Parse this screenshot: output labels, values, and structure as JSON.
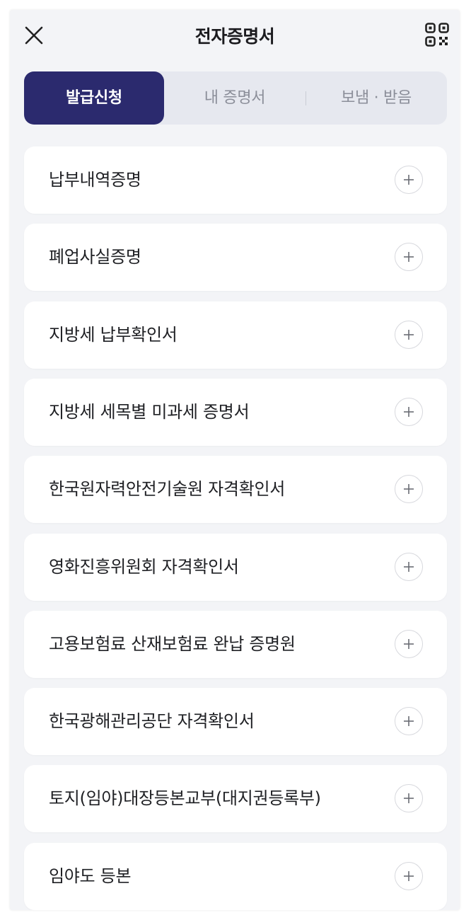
{
  "header": {
    "title": "전자증명서",
    "close_icon": "close-icon",
    "qr_icon": "qr-code-icon"
  },
  "tabs": [
    {
      "label": "발급신청",
      "active": true
    },
    {
      "label": "내 증명서",
      "active": false
    },
    {
      "label": "보냄 · 받음",
      "active": false
    }
  ],
  "certificates": [
    {
      "label": "납부내역증명"
    },
    {
      "label": "폐업사실증명"
    },
    {
      "label": "지방세 납부확인서"
    },
    {
      "label": "지방세 세목별 미과세 증명서"
    },
    {
      "label": "한국원자력안전기술원 자격확인서"
    },
    {
      "label": "영화진흥위원회 자격확인서"
    },
    {
      "label": "고용보험료 산재보험료 완납 증명원"
    },
    {
      "label": "한국광해관리공단 자격확인서"
    },
    {
      "label": "토지(임야)대장등본교부(대지권등록부)"
    },
    {
      "label": "임야도 등본"
    }
  ],
  "colors": {
    "accent": "#2b2a6e",
    "background": "#f3f4f7",
    "tab_bar": "#e6e8ef"
  }
}
